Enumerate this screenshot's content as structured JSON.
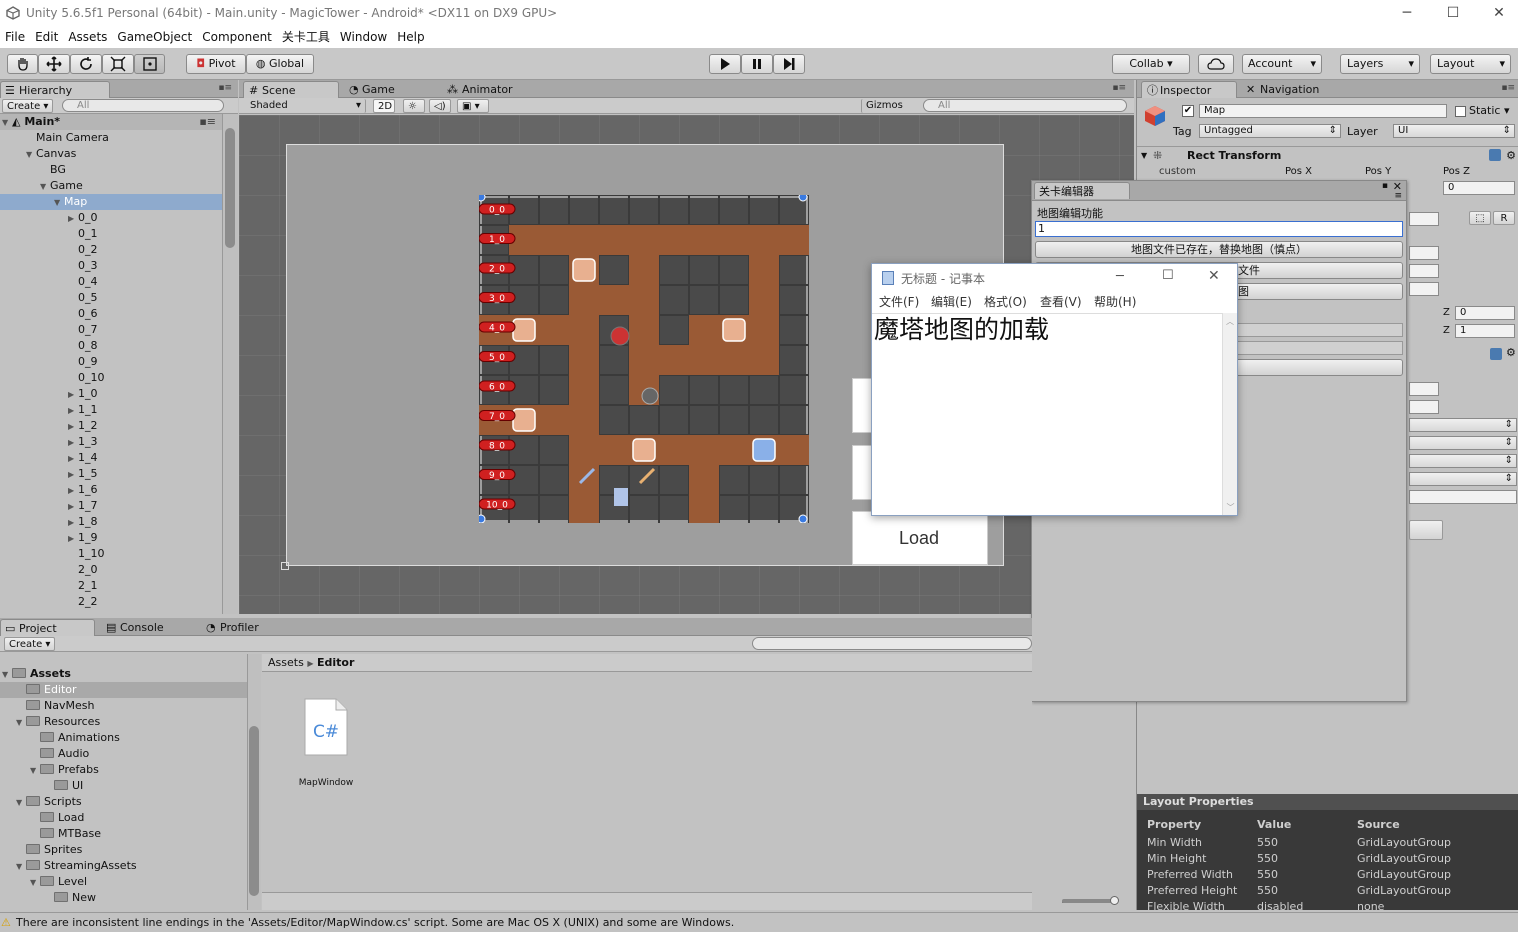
{
  "window": {
    "title": "Unity 5.6.5f1 Personal (64bit) - Main.unity - MagicTower - Android* <DX11 on DX9 GPU>",
    "minimize": "─",
    "maximize": "☐",
    "close": "✕"
  },
  "menu": [
    "File",
    "Edit",
    "Assets",
    "GameObject",
    "Component",
    "关卡工具",
    "Window",
    "Help"
  ],
  "toolbar": {
    "pivot": "Pivot",
    "global": "Global",
    "collab": "Collab ▾",
    "account": "Account",
    "layers": "Layers",
    "layout": "Layout"
  },
  "hierarchy": {
    "tab": "Hierarchy",
    "create": "Create",
    "search": "All",
    "scene": "Main*",
    "items": [
      {
        "label": "Main Camera",
        "indent": 1,
        "arrow": ""
      },
      {
        "label": "Canvas",
        "indent": 1,
        "arrow": "▼"
      },
      {
        "label": "BG",
        "indent": 2,
        "arrow": ""
      },
      {
        "label": "Game",
        "indent": 2,
        "arrow": "▼"
      },
      {
        "label": "Map",
        "indent": 3,
        "arrow": "▼",
        "selected": true
      },
      {
        "label": "0_0",
        "indent": 4,
        "arrow": "▶"
      },
      {
        "label": "0_1",
        "indent": 4,
        "arrow": ""
      },
      {
        "label": "0_2",
        "indent": 4,
        "arrow": ""
      },
      {
        "label": "0_3",
        "indent": 4,
        "arrow": ""
      },
      {
        "label": "0_4",
        "indent": 4,
        "arrow": ""
      },
      {
        "label": "0_5",
        "indent": 4,
        "arrow": ""
      },
      {
        "label": "0_6",
        "indent": 4,
        "arrow": ""
      },
      {
        "label": "0_7",
        "indent": 4,
        "arrow": ""
      },
      {
        "label": "0_8",
        "indent": 4,
        "arrow": ""
      },
      {
        "label": "0_9",
        "indent": 4,
        "arrow": ""
      },
      {
        "label": "0_10",
        "indent": 4,
        "arrow": ""
      },
      {
        "label": "1_0",
        "indent": 4,
        "arrow": "▶"
      },
      {
        "label": "1_1",
        "indent": 4,
        "arrow": "▶"
      },
      {
        "label": "1_2",
        "indent": 4,
        "arrow": "▶"
      },
      {
        "label": "1_3",
        "indent": 4,
        "arrow": "▶"
      },
      {
        "label": "1_4",
        "indent": 4,
        "arrow": "▶"
      },
      {
        "label": "1_5",
        "indent": 4,
        "arrow": "▶"
      },
      {
        "label": "1_6",
        "indent": 4,
        "arrow": "▶"
      },
      {
        "label": "1_7",
        "indent": 4,
        "arrow": "▶"
      },
      {
        "label": "1_8",
        "indent": 4,
        "arrow": "▶"
      },
      {
        "label": "1_9",
        "indent": 4,
        "arrow": "▶"
      },
      {
        "label": "1_10",
        "indent": 4,
        "arrow": ""
      },
      {
        "label": "2_0",
        "indent": 4,
        "arrow": ""
      },
      {
        "label": "2_1",
        "indent": 4,
        "arrow": ""
      },
      {
        "label": "2_2",
        "indent": 4,
        "arrow": ""
      }
    ]
  },
  "scene": {
    "tabs": [
      "Scene",
      "Game",
      "Animator"
    ],
    "shaded": "Shaded",
    "mode2d": "2D",
    "gizmos": "Gizmos",
    "search": "All",
    "row_labels": [
      "0_0",
      "1_0",
      "2_0",
      "3_0",
      "4_0",
      "5_0",
      "6_0",
      "7_0",
      "8_0",
      "9_0",
      "10_0"
    ],
    "load_button": "Load"
  },
  "inspector": {
    "tabs": [
      "Inspector",
      "Navigation"
    ],
    "name": "Map",
    "static": "Static",
    "tag_label": "Tag",
    "tag": "Untagged",
    "layer_label": "Layer",
    "layer": "UI",
    "rect_transform": "Rect Transform",
    "custom": "custom",
    "posx": "Pos X",
    "posy": "Pos Y",
    "posz": "Pos Z",
    "posz_val": "0",
    "r_btn": "R",
    "z_label": "Z",
    "z0": "0",
    "z1": "1",
    "layout_props": {
      "title": "Layout Properties",
      "headers": [
        "Property",
        "Value",
        "Source"
      ],
      "rows": [
        [
          "Min Width",
          "550",
          "GridLayoutGroup"
        ],
        [
          "Min Height",
          "550",
          "GridLayoutGroup"
        ],
        [
          "Preferred Width",
          "550",
          "GridLayoutGroup"
        ],
        [
          "Preferred Height",
          "550",
          "GridLayoutGroup"
        ],
        [
          "Flexible Width",
          "disabled",
          "none"
        ]
      ]
    }
  },
  "level_editor": {
    "title": "关卡编辑器",
    "section": "地图编辑功能",
    "input": "1",
    "exists_button": "地图文件已存在，替换地图（慎点）",
    "button2_tail": "文件",
    "button3_tail": "图"
  },
  "notepad": {
    "title": "无标题 - 记事本",
    "menu": [
      "文件(F)",
      "编辑(E)",
      "格式(O)",
      "查看(V)",
      "帮助(H)"
    ],
    "content": "魔塔地图的加载"
  },
  "project": {
    "tabs": [
      "Project",
      "Console",
      "Profiler"
    ],
    "create": "Create",
    "breadcrumb": [
      "Assets",
      "Editor"
    ],
    "tree": [
      {
        "label": "Assets",
        "indent": 0,
        "arrow": "▼",
        "bold": true
      },
      {
        "label": "Editor",
        "indent": 1,
        "arrow": "",
        "selected": true
      },
      {
        "label": "NavMesh",
        "indent": 1,
        "arrow": ""
      },
      {
        "label": "Resources",
        "indent": 1,
        "arrow": "▼"
      },
      {
        "label": "Animations",
        "indent": 2,
        "arrow": ""
      },
      {
        "label": "Audio",
        "indent": 2,
        "arrow": ""
      },
      {
        "label": "Prefabs",
        "indent": 2,
        "arrow": "▼"
      },
      {
        "label": "UI",
        "indent": 3,
        "arrow": ""
      },
      {
        "label": "Scripts",
        "indent": 1,
        "arrow": "▼"
      },
      {
        "label": "Load",
        "indent": 2,
        "arrow": ""
      },
      {
        "label": "MTBase",
        "indent": 2,
        "arrow": ""
      },
      {
        "label": "Sprites",
        "indent": 1,
        "arrow": ""
      },
      {
        "label": "StreamingAssets",
        "indent": 1,
        "arrow": "▼"
      },
      {
        "label": "Level",
        "indent": 2,
        "arrow": "▼"
      },
      {
        "label": "New",
        "indent": 3,
        "arrow": ""
      }
    ],
    "asset": {
      "name": "MapWindow",
      "icon": "C#"
    }
  },
  "status": {
    "message": "There are inconsistent line endings in the 'Assets/Editor/MapWindow.cs' script. Some are Mac OS X (UNIX) and some are Windows."
  }
}
